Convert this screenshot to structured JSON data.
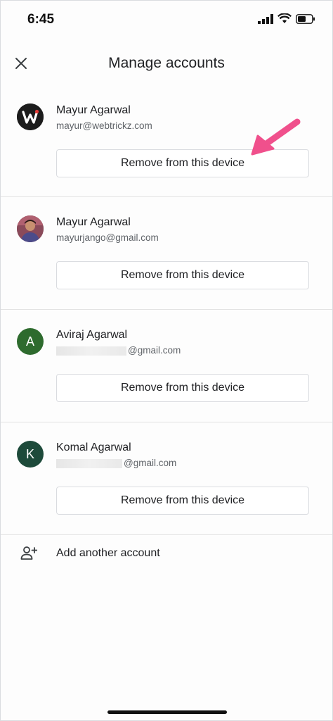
{
  "status": {
    "time": "6:45"
  },
  "header": {
    "title": "Manage accounts"
  },
  "accounts": [
    {
      "name": "Mayur Agarwal",
      "email_visible": "mayur@webtrickz.com",
      "email_hidden": false,
      "avatar_type": "logo",
      "avatar_bg": "#1c1c1c",
      "remove_label": "Remove from this device"
    },
    {
      "name": "Mayur Agarwal",
      "email_visible": "mayurjango@gmail.com",
      "email_hidden": false,
      "avatar_type": "photo",
      "avatar_bg": "#6b3a4a",
      "remove_label": "Remove from this device"
    },
    {
      "name": "Aviraj Agarwal",
      "email_visible": "@gmail.com",
      "email_hidden": true,
      "avatar_type": "letter",
      "avatar_letter": "A",
      "avatar_bg": "#2e6b2e",
      "remove_label": "Remove from this device"
    },
    {
      "name": "Komal Agarwal",
      "email_visible": "@gmail.com",
      "email_hidden": true,
      "avatar_type": "letter",
      "avatar_letter": "K",
      "avatar_bg": "#1d4a3a",
      "remove_label": "Remove from this device"
    }
  ],
  "add_account": {
    "label": "Add another account",
    "icon": "person-add-icon"
  },
  "colors": {
    "annotation_arrow": "#f0508c",
    "divider": "#e3e3e3"
  }
}
